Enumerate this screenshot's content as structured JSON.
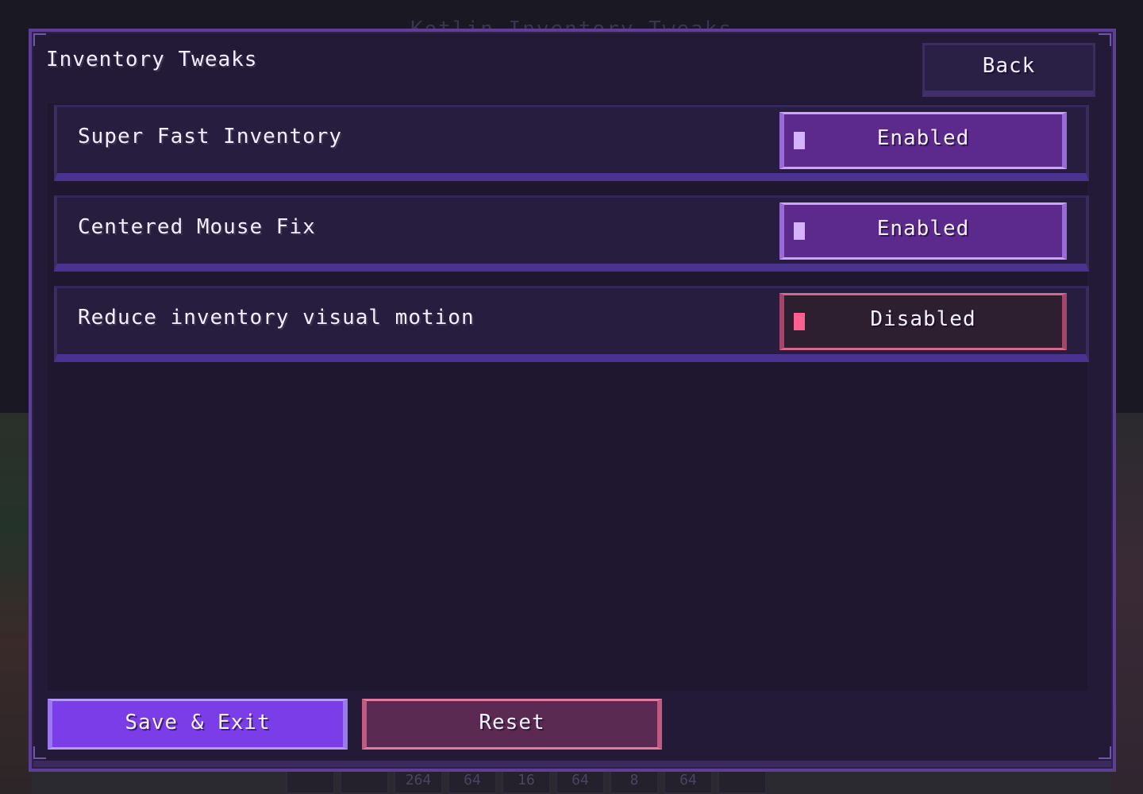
{
  "background": {
    "ghost_title": "Kotlin Inventory Tweaks",
    "hotbar": [
      "",
      "",
      "264",
      "64",
      "16",
      "64",
      "8",
      "64",
      "",
      ""
    ]
  },
  "header": {
    "title": "Inventory Tweaks",
    "back_label": "Back"
  },
  "settings": [
    {
      "label": "Super Fast Inventory",
      "value": "Enabled",
      "enabled": true
    },
    {
      "label": "Centered Mouse Fix",
      "value": "Enabled",
      "enabled": true
    },
    {
      "label": "Reduce inventory visual motion",
      "value": "Disabled",
      "enabled": false
    }
  ],
  "footer": {
    "save_label": "Save & Exit",
    "reset_label": "Reset"
  },
  "colors": {
    "accent": "#7a3de8",
    "enabled": "#5b2a8c",
    "disabled": "#d8678e",
    "panel": "#221a36"
  }
}
